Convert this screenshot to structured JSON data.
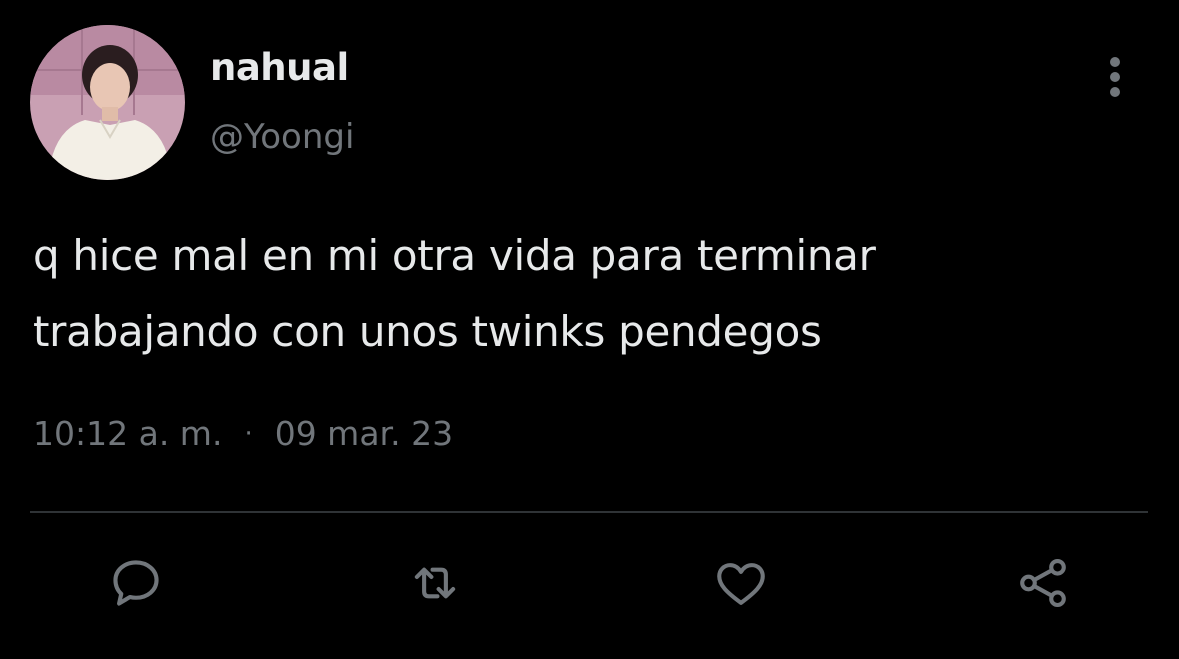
{
  "tweet": {
    "display_name": "nahual",
    "handle": "@Yoongi",
    "text_lines": [
      "q hice mal en mi otra vida para terminar",
      "trabajando con unos twinks pendegos"
    ],
    "time": "10:12 a. m.",
    "separator": "·",
    "date": "09 mar. 23"
  },
  "icons": {
    "more": "more-vertical-icon",
    "reply": "reply-icon",
    "retweet": "retweet-icon",
    "like": "heart-icon",
    "share": "share-icon"
  },
  "colors": {
    "background": "#000000",
    "primary_text": "#e7e9ea",
    "secondary_text": "#71767b",
    "divider": "#2f3336",
    "icon": "#71767b"
  }
}
